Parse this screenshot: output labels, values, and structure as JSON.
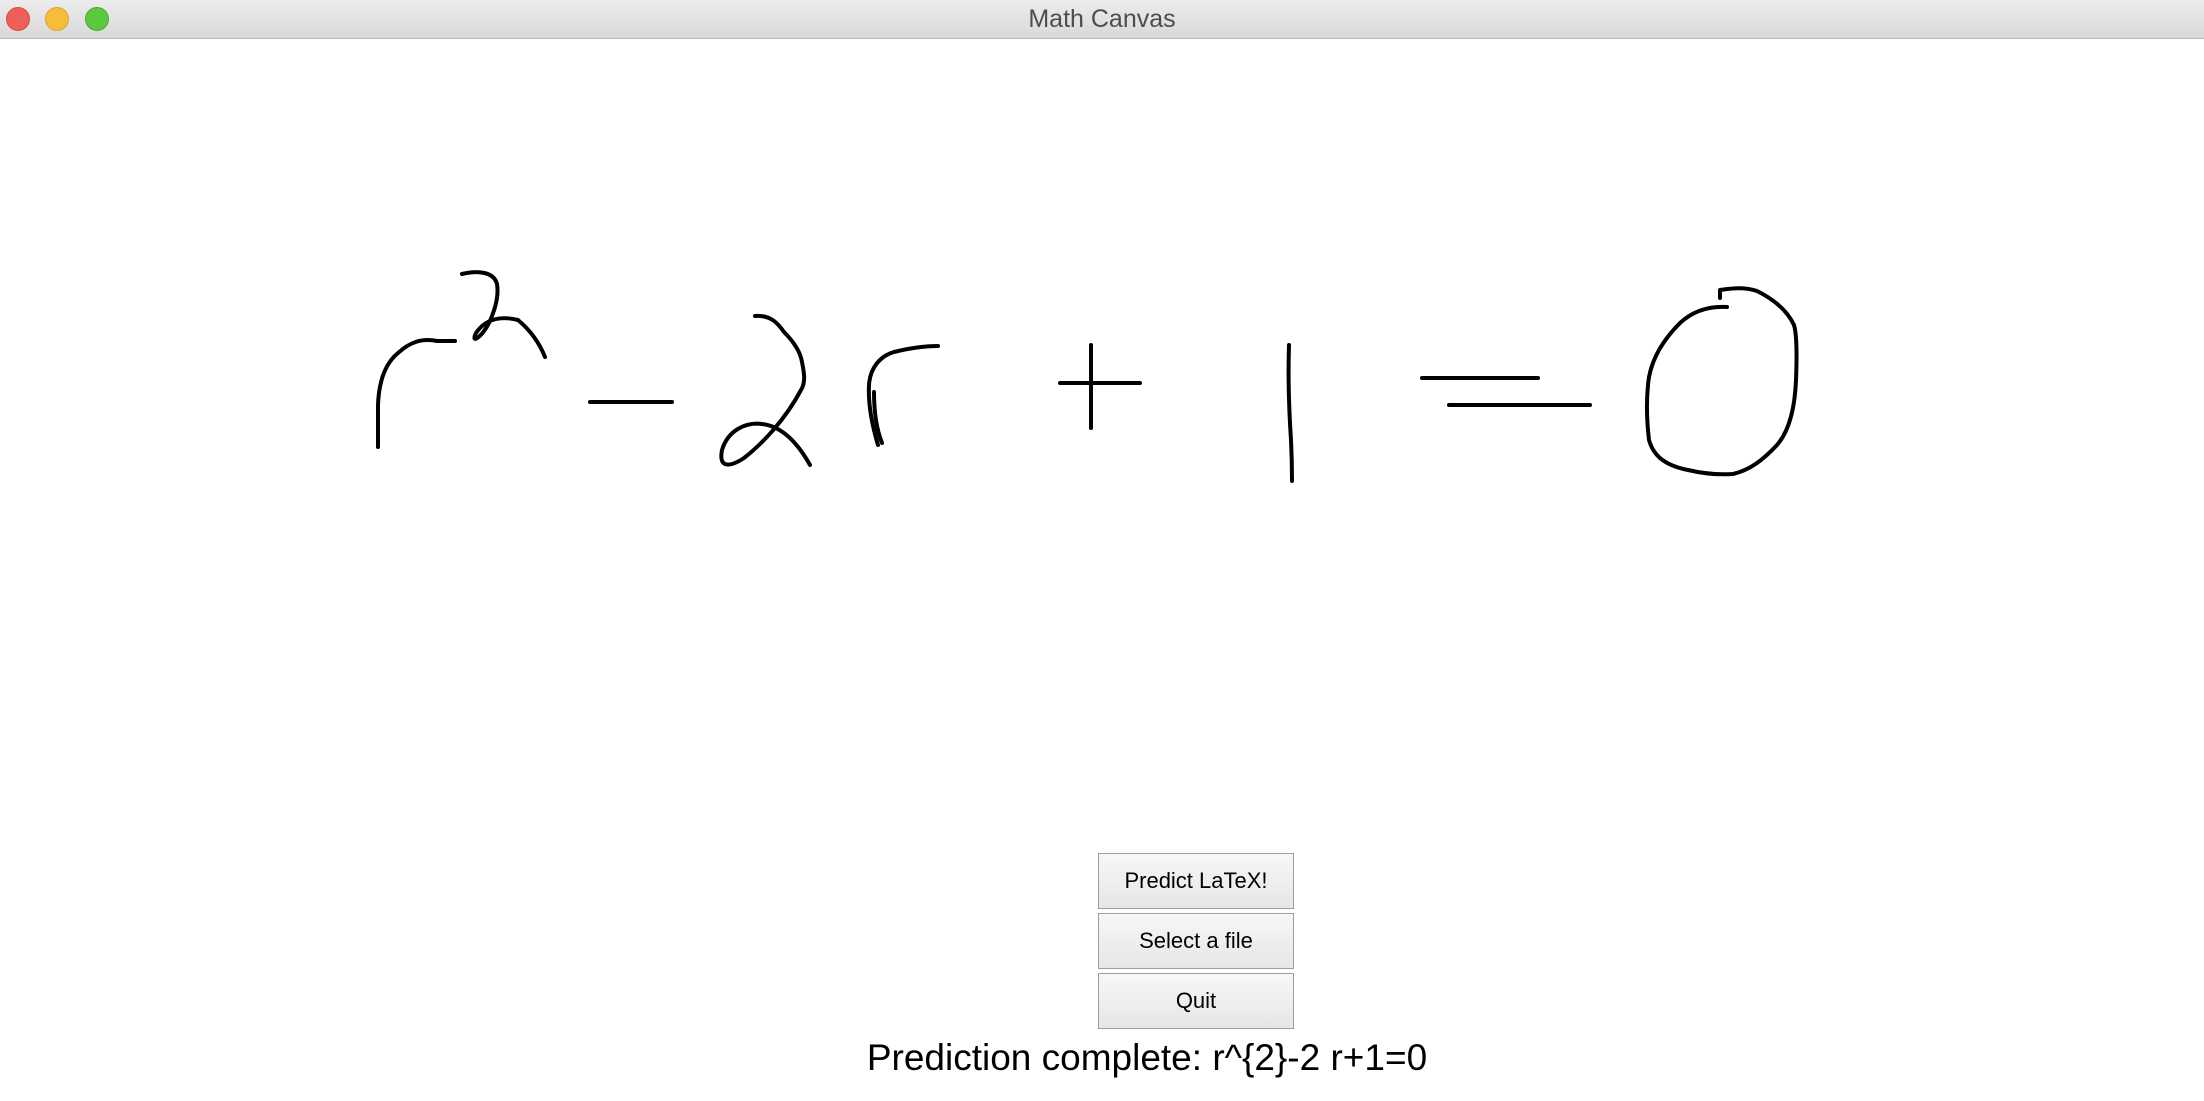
{
  "window": {
    "title": "Math Canvas"
  },
  "titlebar": {
    "buttons": [
      {
        "name": "close",
        "color": "#ee5f57"
      },
      {
        "name": "minimize",
        "color": "#f6bd3b"
      },
      {
        "name": "zoom",
        "color": "#5cc840"
      }
    ]
  },
  "canvas": {
    "stroke_color": "#000000",
    "background": "#ffffff"
  },
  "controls": {
    "predict_label": "Predict LaTeX!",
    "select_label": "Select a file",
    "quit_label": "Quit"
  },
  "status": {
    "text": "Prediction complete: r^{2}-2 r+1=0"
  }
}
